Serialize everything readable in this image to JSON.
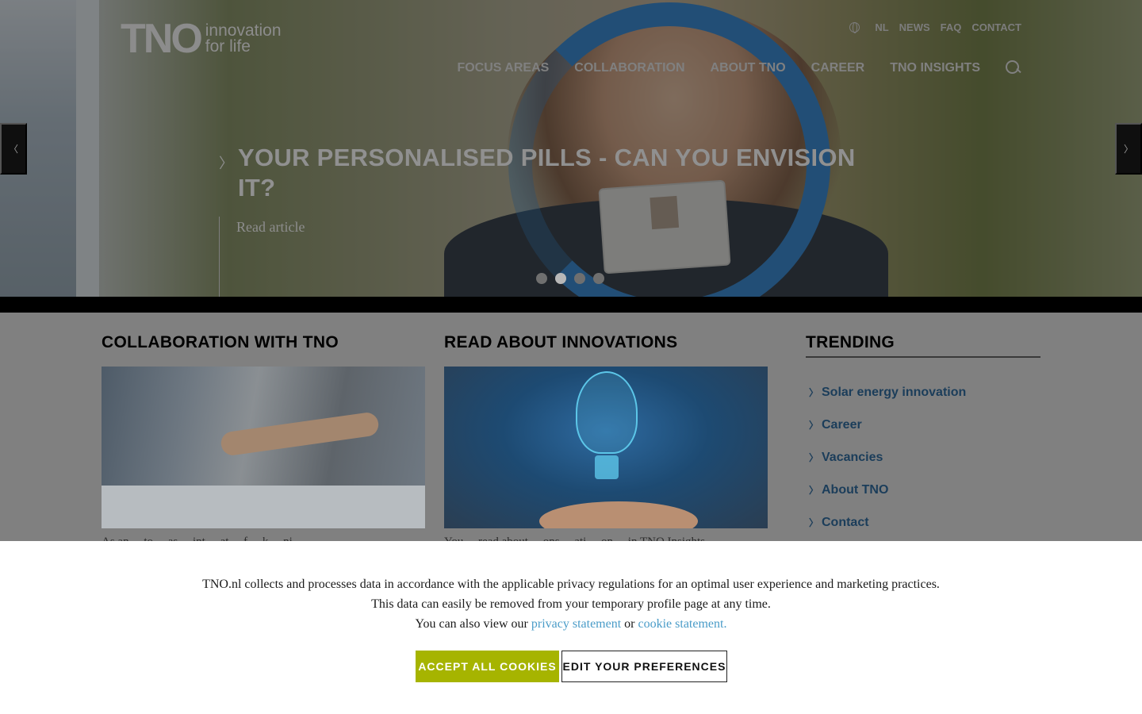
{
  "logo": {
    "mark": "TNO",
    "tagline_line1": "innovation",
    "tagline_line2": "for life"
  },
  "utility_nav": {
    "icon": "globe-icon",
    "items": [
      "NL",
      "NEWS",
      "FAQ",
      "CONTACT"
    ]
  },
  "main_nav": {
    "items": [
      "FOCUS AREAS",
      "COLLABORATION",
      "ABOUT TNO",
      "CAREER",
      "TNO INSIGHTS"
    ],
    "search_icon": "search-icon"
  },
  "hero": {
    "title": "YOUR PERSONALISED PILLS - CAN YOU ENVISION IT?",
    "link": "Read article",
    "chevron": "〉",
    "slides_total": 4,
    "active_slide": 2,
    "prev_arrow": "〈",
    "next_arrow": "〉"
  },
  "columns": {
    "collaboration": {
      "title": "COLLABORATION WITH TNO",
      "peek_text": "As an ... to ... as ... int ... at ... f ... k ... ni"
    },
    "innovations": {
      "title": "READ ABOUT INNOVATIONS",
      "peek_text": "You ... read about ... ons ... ati ... on ... in TNO Insights"
    }
  },
  "trending": {
    "title": "TRENDING",
    "items": [
      "Solar energy innovation",
      "Career",
      "Vacancies",
      "About TNO",
      "Contact"
    ]
  },
  "cookie": {
    "line1": "TNO.nl collects and processes data in accordance with the applicable privacy regulations for an optimal user experience and marketing practices.",
    "line2": "This data can easily be removed from your temporary profile page at any time.",
    "line3_prefix": "You can also view our",
    "privacy_link": "privacy statement",
    "or": "or",
    "cookie_link": "cookie statement.",
    "accept_label": "ACCEPT ALL COOKIES",
    "edit_label": "EDIT YOUR PREFERENCES"
  },
  "colors": {
    "accent_green": "#a6b400",
    "link_blue": "#4a9cc8",
    "trending_text": "#1b3d5a",
    "ring_blue": "#3f8fd8"
  }
}
